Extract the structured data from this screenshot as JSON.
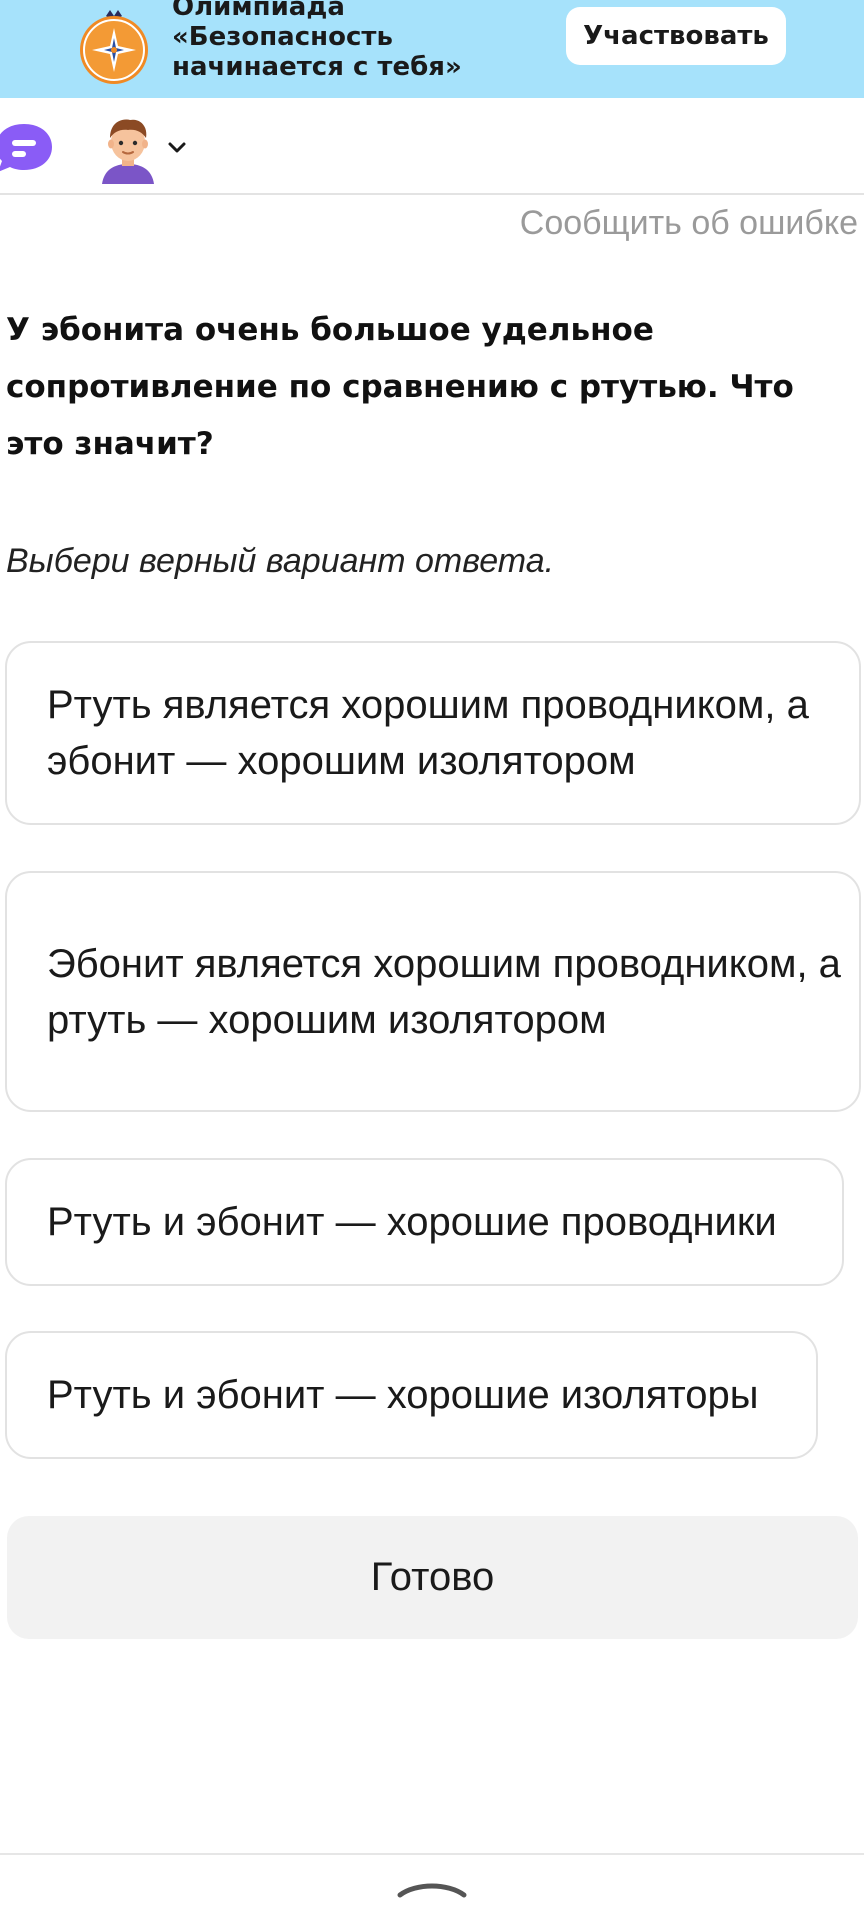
{
  "banner": {
    "title_lines": [
      "Олимпиада",
      "«Безопасность",
      "начинается с тебя»"
    ],
    "button_label": "Участвовать",
    "background_color": "#a6e2fb",
    "logo_icon": "emergency-ministry-emblem-icon"
  },
  "nav": {
    "chat_icon": "chat-bubble-icon",
    "avatar_icon": "user-avatar-icon",
    "chevron_icon": "chevron-down-icon",
    "chat_color": "#8a5cf6"
  },
  "report_link": "Сообщить об ошибке",
  "question": {
    "text": "У эбонита очень большое удельное сопротивление по сравнению с ртутью. Что это значит?",
    "instruction": "Выбери верный вариант ответа."
  },
  "options": [
    {
      "label": "Ртуть является хорошим проводником, а эбонит — хорошим изолятором"
    },
    {
      "label": "Эбонит является хорошим проводником, а ртуть — хорошим изолятором"
    },
    {
      "label": "Ртуть и эбонит — хорошие проводники"
    },
    {
      "label": "Ртуть и эбонит — хорошие изоляторы"
    }
  ],
  "done_label": "Готово",
  "bottom_sheet": {
    "handle_icon": "chevron-up-icon"
  }
}
